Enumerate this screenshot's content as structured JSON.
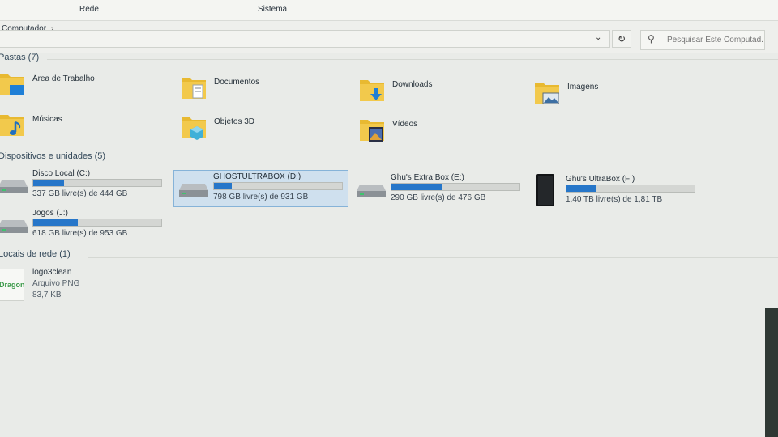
{
  "ribbon": {
    "tabs": [
      "Rede",
      "Sistema"
    ]
  },
  "address": {
    "crumb": "Computador",
    "chevron": "›"
  },
  "search": {
    "placeholder": "Pesquisar Este Computad..."
  },
  "groups": {
    "pastas": "Pastas (7)",
    "dispositivos": "Dispositivos e unidades (5)",
    "locais": "Locais de rede (1)"
  },
  "folders": [
    {
      "label": "Área de Trabalho",
      "icon": "desktop-folder-icon"
    },
    {
      "label": "Documentos",
      "icon": "documents-folder-icon"
    },
    {
      "label": "Downloads",
      "icon": "downloads-folder-icon"
    },
    {
      "label": "Imagens",
      "icon": "pictures-folder-icon"
    },
    {
      "label": "Músicas",
      "icon": "music-folder-icon"
    },
    {
      "label": "Objetos 3D",
      "icon": "3d-objects-folder-icon"
    },
    {
      "label": "Vídeos",
      "icon": "videos-folder-icon"
    }
  ],
  "drives": [
    {
      "name": "Disco Local (C:)",
      "free": "337 GB livre(s) de 444 GB",
      "used_fraction": 0.24,
      "icon": "hard-drive-icon"
    },
    {
      "name": "GHOSTULTRABOX (D:)",
      "free": "798 GB livre(s) de 931 GB",
      "used_fraction": 0.14,
      "selected": true,
      "icon": "hard-drive-icon"
    },
    {
      "name": "Ghu's Extra Box (E:)",
      "free": "290 GB livre(s) de 476 GB",
      "used_fraction": 0.39,
      "icon": "hard-drive-icon"
    },
    {
      "name": "Ghu's UltraBox (F:)",
      "free": "1,40 TB livre(s) de 1,81 TB",
      "used_fraction": 0.23,
      "icon": "external-drive-icon"
    },
    {
      "name": "Jogos (J:)",
      "free": "618 GB livre(s) de 953 GB",
      "used_fraction": 0.35,
      "icon": "hard-drive-icon"
    }
  ],
  "network": {
    "name": "logo3clean",
    "type": "Arquivo PNG",
    "size": "83,7 KB",
    "thumb_text": "Dragon"
  },
  "colors": {
    "accent": "#2676c9",
    "selection": "#cfe0ee",
    "folder": "#e8b931"
  }
}
